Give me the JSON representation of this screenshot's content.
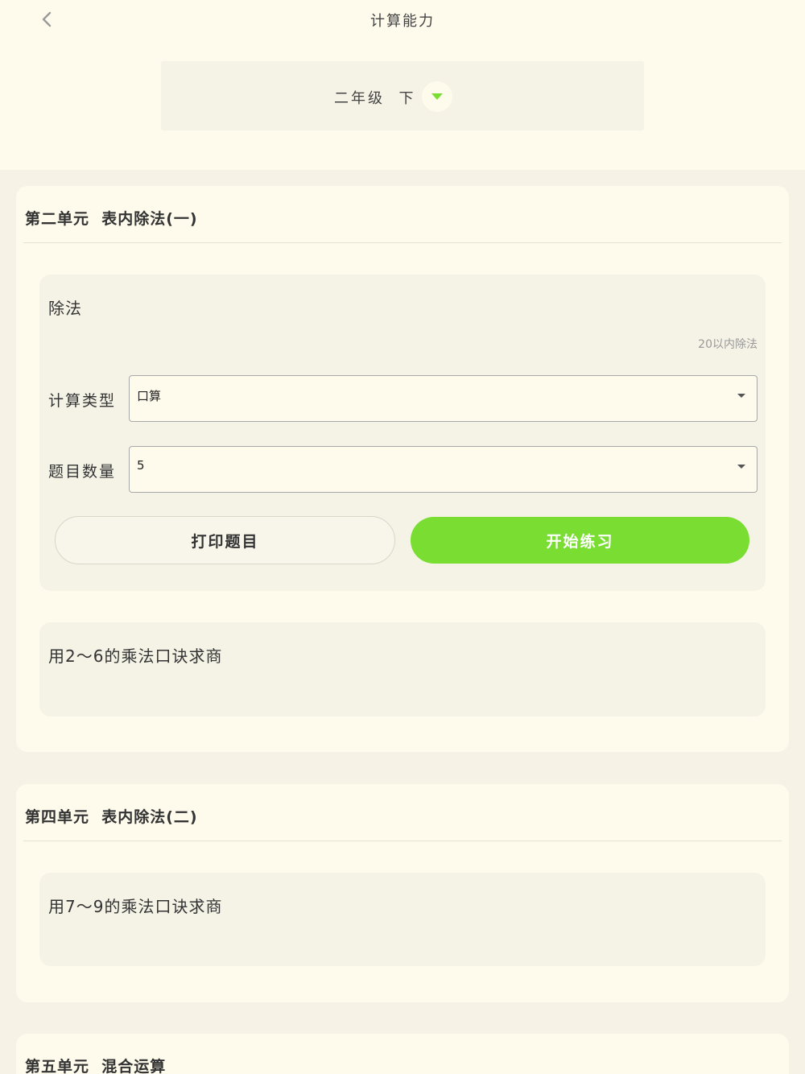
{
  "header": {
    "title": "计算能力",
    "back_icon": "chevron-left-icon"
  },
  "grade_selector": {
    "label": "二年级  下",
    "toggle_icon": "caret-down-icon",
    "accent_color": "#7ade32"
  },
  "units": [
    {
      "title": "第二单元  表内除法(一)",
      "lessons": [
        {
          "title": "除法",
          "note": "20以内除法",
          "calc_type": {
            "label": "计算类型",
            "value": "口算"
          },
          "question_count": {
            "label": "题目数量",
            "value": "5"
          },
          "print_button": "打印题目",
          "start_button": "开始练习"
        },
        {
          "title": "用2～6的乘法口诀求商"
        }
      ]
    },
    {
      "title": "第四单元  表内除法(二)",
      "lessons": [
        {
          "title": "用7～9的乘法口诀求商"
        }
      ]
    },
    {
      "title": "第五单元  混合运算",
      "lessons": []
    }
  ]
}
